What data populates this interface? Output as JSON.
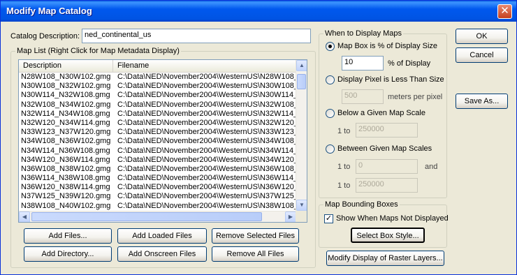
{
  "window": {
    "title": "Modify Map Catalog",
    "close_label": "✕"
  },
  "catalog": {
    "label": "Catalog Description:",
    "value": "ned_continental_us"
  },
  "map_list": {
    "group_title": "Map List (Right Click for Map Metadata Display)",
    "columns": [
      "Description",
      "Filename"
    ],
    "rows": [
      [
        "N28W108_N30W102.gmg",
        "C:\\Data\\NED\\November2004\\WesternUS\\N28W108_N30W102.gmg"
      ],
      [
        "N30W108_N32W102.gmg",
        "C:\\Data\\NED\\November2004\\WesternUS\\N30W108_N32W102.gmg"
      ],
      [
        "N30W114_N32W108.gmg",
        "C:\\Data\\NED\\November2004\\WesternUS\\N30W114_N32W108.gmg"
      ],
      [
        "N32W108_N34W102.gmg",
        "C:\\Data\\NED\\November2004\\WesternUS\\N32W108_N34W102.gmg"
      ],
      [
        "N32W114_N34W108.gmg",
        "C:\\Data\\NED\\November2004\\WesternUS\\N32W114_N34W108.gmg"
      ],
      [
        "N32W120_N34W114.gmg",
        "C:\\Data\\NED\\November2004\\WesternUS\\N32W120_N34W114.gmg"
      ],
      [
        "N33W123_N37W120.gmg",
        "C:\\Data\\NED\\November2004\\WesternUS\\N33W123_N37W120.gmg"
      ],
      [
        "N34W108_N36W102.gmg",
        "C:\\Data\\NED\\November2004\\WesternUS\\N34W108_N36W102.gmg"
      ],
      [
        "N34W114_N36W108.gmg",
        "C:\\Data\\NED\\November2004\\WesternUS\\N34W114_N36W108.gmg"
      ],
      [
        "N34W120_N36W114.gmg",
        "C:\\Data\\NED\\November2004\\WesternUS\\N34W120_N36W114.gmg"
      ],
      [
        "N36W108_N38W102.gmg",
        "C:\\Data\\NED\\November2004\\WesternUS\\N36W108_N38W102.gmg"
      ],
      [
        "N36W114_N38W108.gmg",
        "C:\\Data\\NED\\November2004\\WesternUS\\N36W114_N38W108.gmg"
      ],
      [
        "N36W120_N38W114.gmg",
        "C:\\Data\\NED\\November2004\\WesternUS\\N36W120_N38W114.gmg"
      ],
      [
        "N37W125_N39W120.gmg",
        "C:\\Data\\NED\\November2004\\WesternUS\\N37W125_N39W120.gmg"
      ],
      [
        "N38W108_N40W102.gmg",
        "C:\\Data\\NED\\November2004\\WesternUS\\N38W108_N40W102.gmg"
      ]
    ]
  },
  "list_buttons": {
    "add_files": "Add Files...",
    "add_loaded": "Add Loaded Files",
    "remove_selected": "Remove Selected Files",
    "add_directory": "Add Directory...",
    "add_onscreen": "Add Onscreen Files",
    "remove_all": "Remove All Files"
  },
  "when_display": {
    "group_title": "When to Display Maps",
    "opt_mapbox": "Map Box is % of Display Size",
    "mapbox_value": "10",
    "mapbox_suffix": "% of Display",
    "opt_pixel": "Display Pixel is Less Than Size",
    "pixel_value": "500",
    "pixel_suffix": "meters per pixel",
    "opt_scale": "Below a Given Map Scale",
    "scale_prefix": "1 to",
    "scale_value": "250000",
    "opt_between": "Between Given Map Scales",
    "between_from_prefix": "1 to",
    "between_from_value": "0",
    "between_and": "and",
    "between_to_prefix": "1 to",
    "between_to_value": "250000"
  },
  "bounding": {
    "group_title": "Map Bounding Boxes",
    "checkbox_label": "Show When Maps Not Displayed",
    "checked": true,
    "select_style": "Select Box Style..."
  },
  "raster_button": "Modify Display of Raster Layers...",
  "side_buttons": {
    "ok": "OK",
    "cancel": "Cancel",
    "save_as": "Save As..."
  }
}
